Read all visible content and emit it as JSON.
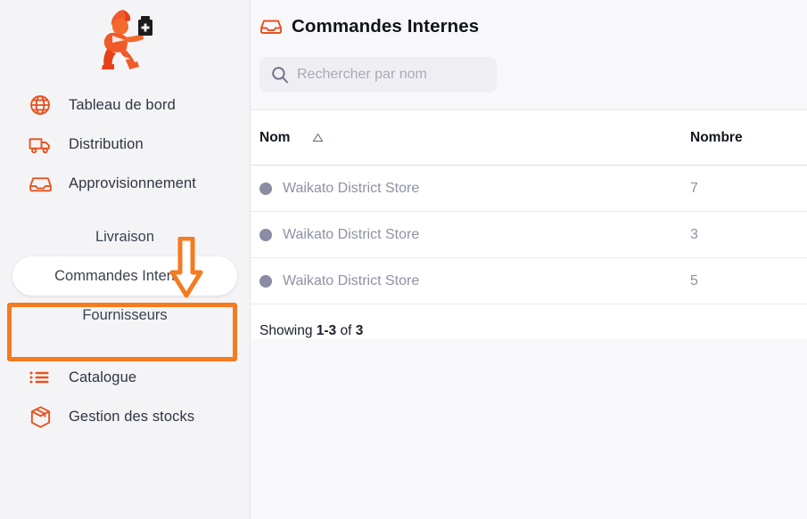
{
  "brand": {
    "logo_name": "running-courier-with-medicine-bottle-logo",
    "accent_color": "#e8511e",
    "annotation_color": "#f47b20"
  },
  "sidebar": {
    "items": [
      {
        "label": "Tableau de bord",
        "icon": "globe-icon"
      },
      {
        "label": "Distribution",
        "icon": "truck-icon"
      },
      {
        "label": "Approvisionnement",
        "icon": "inbox-tray-icon"
      }
    ],
    "subitems": [
      {
        "label": "Livraison",
        "active": false
      },
      {
        "label": "Commandes Internes",
        "active": true
      },
      {
        "label": "Fournisseurs",
        "active": false
      }
    ],
    "bottom_items": [
      {
        "label": "Catalogue",
        "icon": "bulleted-list-icon"
      },
      {
        "label": "Gestion des stocks",
        "icon": "package-box-icon"
      }
    ]
  },
  "main": {
    "title": "Commandes Internes",
    "title_icon": "inbox-tray-icon",
    "search": {
      "placeholder": "Rechercher par nom",
      "value": "",
      "icon": "search-icon"
    },
    "table": {
      "columns": [
        {
          "label": "Nom",
          "sort": "ascending",
          "sort_icon": "triangle-up-icon"
        },
        {
          "label": "Nombre"
        }
      ],
      "rows": [
        {
          "status": "neutral",
          "name": "Waikato District Store",
          "count": "7"
        },
        {
          "status": "neutral",
          "name": "Waikato District Store",
          "count": "3"
        },
        {
          "status": "neutral",
          "name": "Waikato District Store",
          "count": "5"
        }
      ]
    },
    "footer": {
      "showing_prefix": "Showing ",
      "range": "1-3",
      "middle": " of ",
      "total": "3"
    }
  },
  "annotations": {
    "highlight_target": "Commandes Internes",
    "arrow": "down-arrow-pointing-to-commandes-internes"
  }
}
